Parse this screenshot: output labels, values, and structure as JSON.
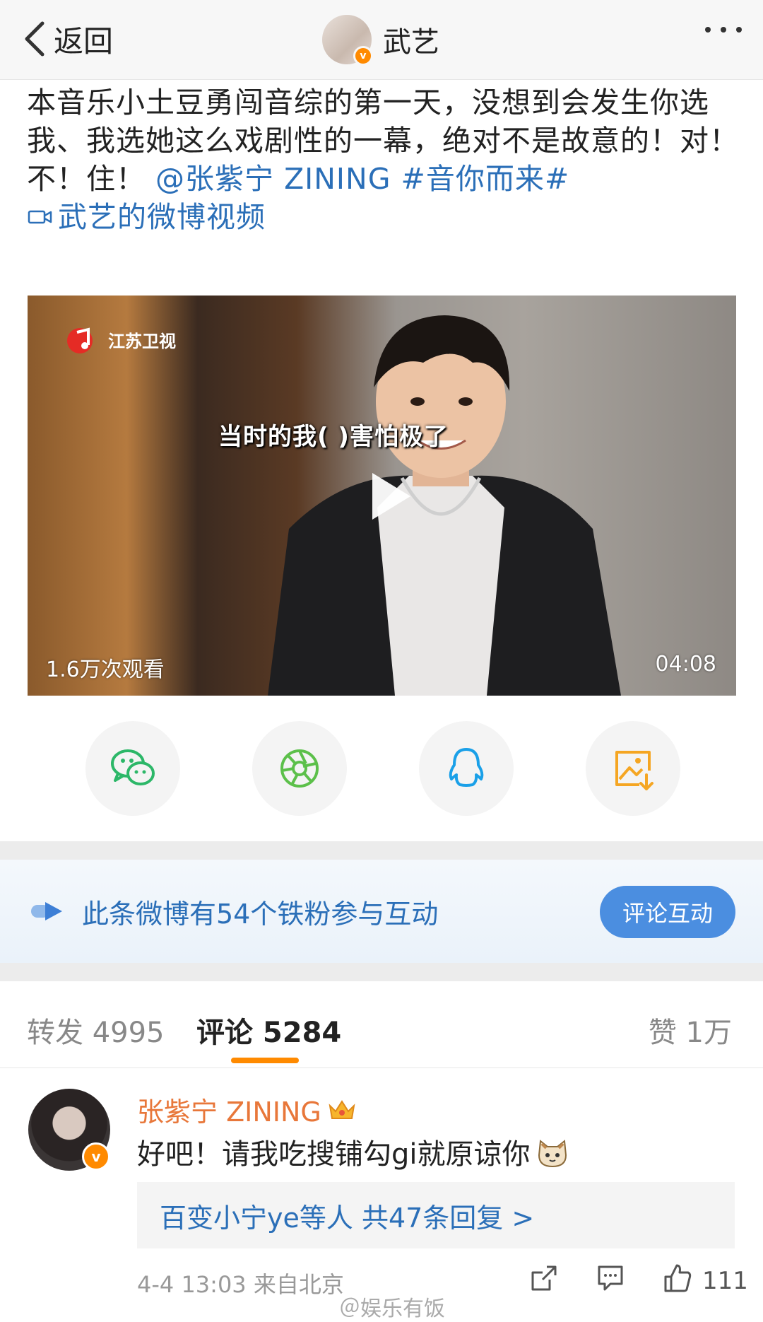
{
  "header": {
    "back_label": "返回",
    "user_name": "武艺"
  },
  "post": {
    "text": "本音乐小土豆勇闯音综的第一天，没想到会发生你选我、我选她这么戏剧性的一幕，绝对不是故意的！对！不！住！",
    "mention": "@张紫宁 ZINING",
    "hashtag": "#音你而来#",
    "video_link": "武艺的微博视频"
  },
  "video": {
    "channel_logo": "江苏卫视",
    "subtitle": "当时的我(           )害怕极了",
    "views": "1.6万次观看",
    "duration": "04:08"
  },
  "share": {
    "icons": [
      "wechat-icon",
      "moments-icon",
      "qq-icon",
      "save-image-icon"
    ]
  },
  "banner": {
    "text": "此条微博有54个铁粉参与互动",
    "button": "评论互动"
  },
  "tabs": {
    "repost": "转发 4995",
    "comment": "评论 5284",
    "like": "赞 1万"
  },
  "comment": {
    "name": "张紫宁 ZINING",
    "text": "好吧！请我吃搜铺勾gi就原谅你",
    "replies": "百变小宁ye等人  共47条回复 >",
    "meta": "4-4 13:03 来自北京",
    "like_count": "111"
  },
  "watermark": "＠娱乐有饭",
  "colors": {
    "link": "#2b6fb8",
    "accent": "#ff8a00",
    "username": "#e8773a",
    "button": "#4b8ee0"
  }
}
